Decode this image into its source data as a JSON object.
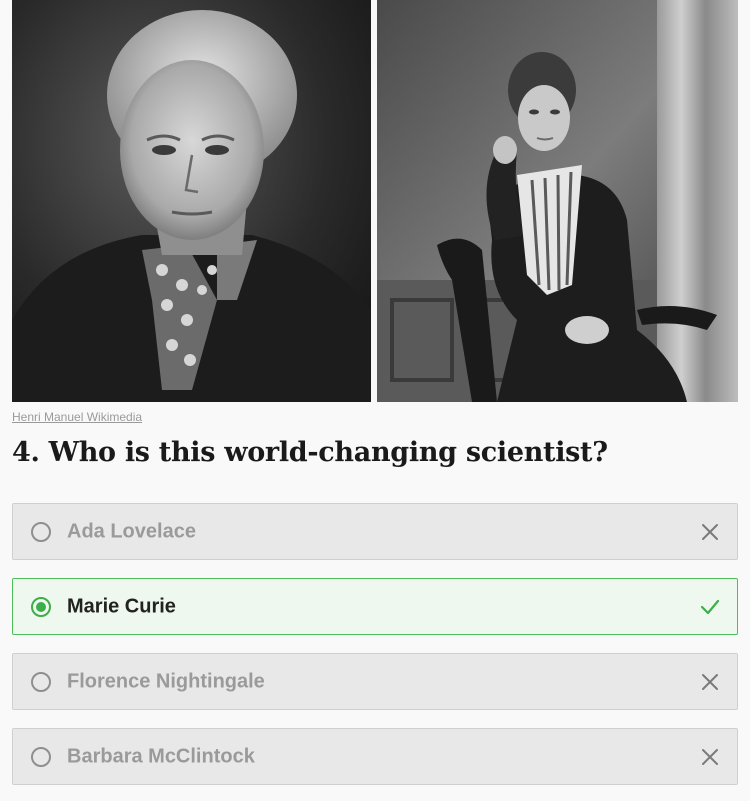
{
  "photos": {
    "credit": "Henri Manuel Wikimedia"
  },
  "question": {
    "text": "4. Who is this world-changing scientist?"
  },
  "options": [
    {
      "label": "Ada Lovelace",
      "state": "wrong",
      "icon": "close-icon"
    },
    {
      "label": "Marie Curie",
      "state": "correct",
      "icon": "check-icon"
    },
    {
      "label": "Florence Nightingale",
      "state": "wrong",
      "icon": "close-icon"
    },
    {
      "label": "Barbara McClintock",
      "state": "wrong",
      "icon": "close-icon"
    }
  ],
  "colors": {
    "correct_accent": "#3dae4a",
    "correct_bg": "#eef8ee",
    "option_bg": "#e8e8e8",
    "muted_text": "#9a9a9a"
  }
}
